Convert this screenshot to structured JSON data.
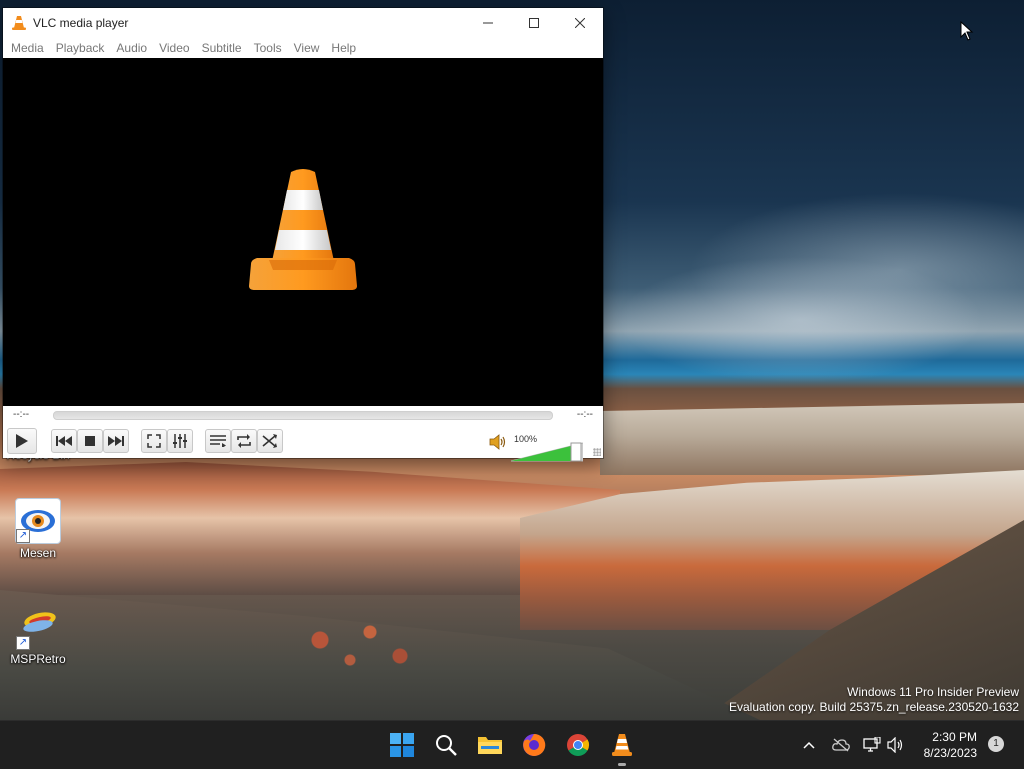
{
  "window": {
    "title": "VLC media player",
    "menu": [
      "Media",
      "Playback",
      "Audio",
      "Video",
      "Subtitle",
      "Tools",
      "View",
      "Help"
    ],
    "time_elapsed": "--:--",
    "time_total": "--:--",
    "volume_label": "100%",
    "volume_level": 1.0,
    "icons": {
      "minimize": "minimize-icon",
      "maximize": "maximize-icon",
      "close": "close-icon",
      "play": "play-icon",
      "prev": "previous-icon",
      "stop": "stop-icon",
      "next": "next-icon",
      "fullscreen": "fullscreen-icon",
      "extended": "extended-settings-icon",
      "playlist": "playlist-icon",
      "loop": "loop-icon",
      "random": "shuffle-icon",
      "volume": "speaker-icon"
    }
  },
  "desktop": {
    "icons": [
      {
        "label": "Recycle Bin"
      },
      {
        "label": "Mesen"
      },
      {
        "label": "MSPRetro"
      }
    ],
    "watermark_line1": "Windows 11 Pro Insider Preview",
    "watermark_line2": "Evaluation copy. Build 25375.zn_release.230520-1632"
  },
  "taskbar": {
    "apps": [
      "start",
      "search",
      "file-explorer",
      "firefox",
      "chrome",
      "vlc"
    ],
    "time": "2:30 PM",
    "date": "8/23/2023",
    "notification_count": "1"
  },
  "colors": {
    "taskbar_bg": "#202020",
    "vlc_orange": "#f28c1c",
    "volume_green": "#3cc13c"
  }
}
